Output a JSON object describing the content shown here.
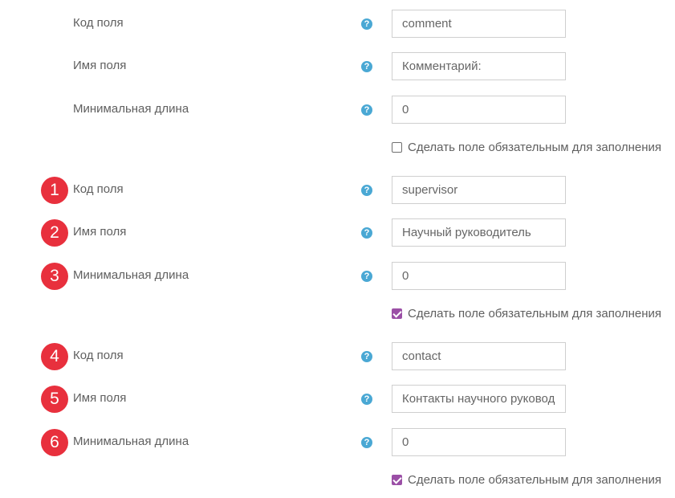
{
  "groups": [
    {
      "rows": [
        {
          "badge": "",
          "label": "Код поля",
          "value": "comment"
        },
        {
          "badge": "",
          "label": "Имя поля",
          "value": "Комментарий:"
        },
        {
          "badge": "",
          "label": "Минимальная длина",
          "value": "0"
        }
      ],
      "required_label": "Сделать поле обязательным для заполнения",
      "required_checked": false
    },
    {
      "rows": [
        {
          "badge": "1",
          "label": "Код поля",
          "value": "supervisor"
        },
        {
          "badge": "2",
          "label": "Имя поля",
          "value": "Научный руководитель"
        },
        {
          "badge": "3",
          "label": "Минимальная длина",
          "value": "0"
        }
      ],
      "required_label": "Сделать поле обязательным для заполнения",
      "required_checked": true
    },
    {
      "rows": [
        {
          "badge": "4",
          "label": "Код поля",
          "value": "contact"
        },
        {
          "badge": "5",
          "label": "Имя поля",
          "value": "Контакты научного руковод"
        },
        {
          "badge": "6",
          "label": "Минимальная длина",
          "value": "0"
        }
      ],
      "required_label": "Сделать поле обязательным для заполнения",
      "required_checked": true
    }
  ],
  "help_glyph": "?",
  "help_icon": "question-circle-icon",
  "colors": {
    "help_icon": "#4aa8d4",
    "checkbox_checked": "#9b4fa6",
    "badge": "#e8303d"
  }
}
